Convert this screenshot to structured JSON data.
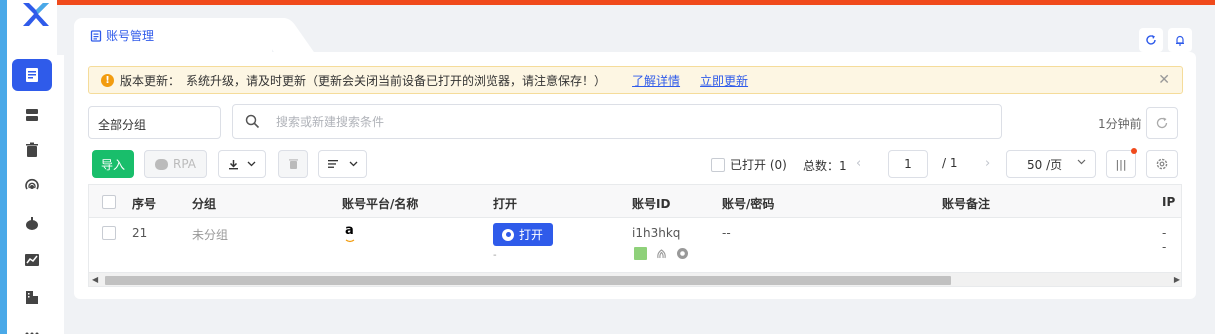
{
  "topbar": {
    "banner_text": "▌"
  },
  "tabs": [
    {
      "label": "账号管理"
    }
  ],
  "notice": {
    "prefix": "版本更新：",
    "message": "系统升级，请及时更新（更新会关闭当前设备已打开的浏览器，请注意保存！）",
    "link_details": "了解详情",
    "link_update": "立即更新",
    "close_glyph": "✕"
  },
  "filters": {
    "group_value": "全部分组",
    "search_placeholder": "搜索或新建搜索条件",
    "time_ago": "1分钟前"
  },
  "toolbar": {
    "import_label": "导入",
    "rpa_label": "RPA",
    "opened_label": "已打开 (0)",
    "total_label": "总数：1",
    "page_current": "1",
    "page_total": "/  1",
    "page_size": "50 /页",
    "columns_glyph": "|||"
  },
  "table": {
    "columns": [
      "序号",
      "分组",
      "账号平台/名称",
      "打开",
      "账号ID",
      "账号/密码",
      "账号备注",
      "IP"
    ],
    "rows": [
      {
        "index": "21",
        "group": "未分组",
        "platform_glyph": "a",
        "open_label": "打开",
        "open_sub": "-",
        "account_id": "i1h3hkq",
        "credentials": "--",
        "note": "",
        "ip_line1": "-",
        "ip_line2": "-"
      }
    ]
  },
  "colors": {
    "accent": "#2f5bea",
    "success": "#19be6b",
    "warning_bar": "#f04a1c",
    "sidebar_border": "#4aa9e8"
  }
}
